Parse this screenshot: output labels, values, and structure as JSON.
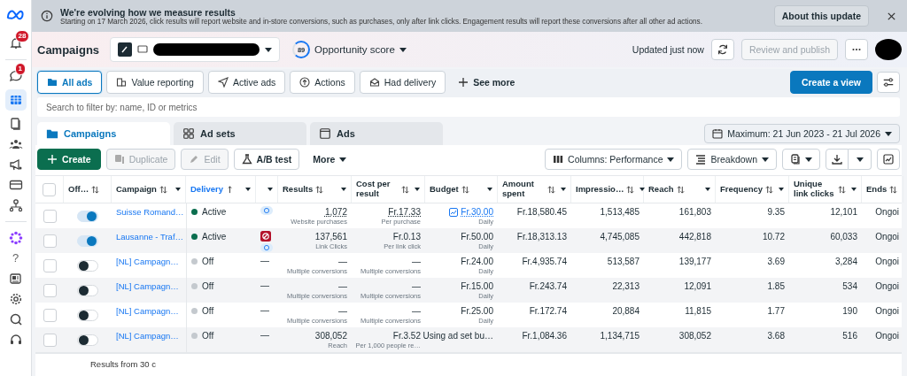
{
  "banner": {
    "title": "We're evolving how we measure results",
    "text": "Starting on 17 March 2026, click results will report website and in-store conversions, such as purchases, only after link clicks. Engagement results will report these conversions after all other ad actions.",
    "button": "About this update"
  },
  "sidebar": {
    "notifications_badge": "28",
    "messages_badge": "1",
    "help_glyph": "?"
  },
  "header": {
    "title": "Campaigns",
    "opportunity_score": "89",
    "opportunity_label": "Opportunity score",
    "updated": "Updated just now",
    "publish_button": "Review and publish",
    "publish_disabled": true
  },
  "filters": [
    {
      "kind": "folder",
      "label": "All ads",
      "selected": true
    },
    {
      "kind": "value",
      "label": "Value reporting",
      "selected": false
    },
    {
      "kind": "send",
      "label": "Active ads",
      "selected": false
    },
    {
      "kind": "actions",
      "label": "Actions",
      "selected": false
    },
    {
      "kind": "delivery",
      "label": "Had delivery",
      "selected": false
    }
  ],
  "see_more": "See more",
  "create_view": "Create a view",
  "search": {
    "placeholder": "Search to filter by: name, ID or metrics"
  },
  "tabs": [
    {
      "kind": "campaigns",
      "label": "Campaigns",
      "selected": true
    },
    {
      "kind": "adsets",
      "label": "Ad sets",
      "selected": false
    },
    {
      "kind": "ads",
      "label": "Ads",
      "selected": false
    }
  ],
  "date_range": "Maximum: 21 Jun 2023 - 21 Jul 2026",
  "toolbar": {
    "create": "Create",
    "actions": [
      {
        "kind": "duplicate",
        "label": "Duplicate",
        "disabled": true
      },
      {
        "kind": "edit",
        "label": "Edit",
        "disabled": true
      },
      {
        "kind": "abtest",
        "label": "A/B test",
        "disabled": false
      }
    ],
    "more": "More",
    "columns": "Columns: Performance",
    "breakdown": "Breakdown"
  },
  "table": {
    "all_checked": false,
    "columns": [
      {
        "label": "Off…",
        "sortable": true,
        "sorted": false,
        "menu": false
      },
      {
        "label": "Campaign",
        "sortable": true,
        "sorted": false,
        "menu": true
      },
      {
        "label": "Delivery",
        "sortable": true,
        "sorted": true,
        "menu": true
      },
      {
        "sortable": false,
        "menu": true
      },
      {
        "label": "Results",
        "sortable": true,
        "sorted": false,
        "menu": true
      },
      {
        "label": "Cost per result",
        "sortable": true,
        "sorted": false,
        "menu": true
      },
      {
        "label": "Budget",
        "sortable": true,
        "sorted": false,
        "menu": true
      },
      {
        "label": "Amount spent",
        "sortable": true,
        "sorted": false,
        "menu": true
      },
      {
        "label": "Impressio…",
        "sortable": true,
        "sorted": false,
        "menu": true
      },
      {
        "label": "Reach",
        "sortable": true,
        "sorted": false,
        "menu": true
      },
      {
        "label": "Frequency",
        "sortable": true,
        "sorted": false,
        "menu": true
      },
      {
        "label": "Unique link clicks",
        "sortable": true,
        "sorted": false,
        "menu": true
      },
      {
        "label": "Ends",
        "sortable": true,
        "sorted": false,
        "menu": false
      }
    ],
    "rows": [
      {
        "checked": false,
        "on": true,
        "name": "Suisse Romand…",
        "delivery": "Active",
        "delivery_on": true,
        "attribution": {
          "kind": "icons",
          "icons": [
            {
              "kind": "setting"
            }
          ]
        },
        "underlined": true,
        "results": "1,072",
        "results_sub": "Website purchases",
        "cost": "Fr.17.33",
        "cost_sub": "Per purchase",
        "budget_link": true,
        "budget": "Fr.30.00",
        "budget_sub": "Daily",
        "amount": "Fr.18,580.45",
        "impressions": "1,513,485",
        "reach": "161,803",
        "frequency": "9.35",
        "unique": "12,101",
        "ends": "Ongoi"
      },
      {
        "checked": false,
        "on": true,
        "name": "Lausanne - Traf…",
        "delivery": "Active",
        "delivery_on": true,
        "attribution": {
          "kind": "icons",
          "icons": [
            {
              "kind": "blocked"
            },
            {
              "kind": "setting"
            }
          ]
        },
        "underlined": false,
        "results": "137,561",
        "results_sub": "Link Clicks",
        "cost": "Fr.0.13",
        "cost_sub": "Per link click",
        "budget_link": false,
        "budget": "Fr.50.00",
        "budget_sub": "Daily",
        "amount": "Fr.18,313.13",
        "impressions": "4,745,085",
        "reach": "442,818",
        "frequency": "10.72",
        "unique": "60,033",
        "ends": "Ongoi"
      },
      {
        "checked": false,
        "on": false,
        "name": "[NL] Campagn…",
        "delivery": "Off",
        "delivery_on": false,
        "attribution": {
          "kind": "text",
          "text": "—"
        },
        "underlined": false,
        "results": "—",
        "results_sub": "Multiple conversions",
        "cost": "—",
        "cost_sub": "Multiple conversions",
        "budget_link": false,
        "budget": "Fr.24.00",
        "budget_sub": "Daily",
        "amount": "Fr.4,935.74",
        "impressions": "513,587",
        "reach": "139,177",
        "frequency": "3.69",
        "unique": "3,284",
        "ends": "Ongoi"
      },
      {
        "checked": false,
        "on": false,
        "name": "[NL] Campagn…",
        "delivery": "Off",
        "delivery_on": false,
        "attribution": {
          "kind": "text",
          "text": "—"
        },
        "underlined": false,
        "results": "—",
        "results_sub": "Multiple conversions",
        "cost": "—",
        "cost_sub": "Multiple conversions",
        "budget_link": false,
        "budget": "Fr.15.00",
        "budget_sub": "Daily",
        "amount": "Fr.243.74",
        "impressions": "22,313",
        "reach": "12,091",
        "frequency": "1.85",
        "unique": "534",
        "ends": "Ongoi"
      },
      {
        "checked": false,
        "on": false,
        "name": "[NL] Campagn…",
        "delivery": "Off",
        "delivery_on": false,
        "attribution": {
          "kind": "text",
          "text": "—"
        },
        "underlined": false,
        "results": "—",
        "results_sub": "Multiple conversions",
        "cost": "—",
        "cost_sub": "Multiple conversions",
        "budget_link": false,
        "budget": "Fr.25.00",
        "budget_sub": "Daily",
        "amount": "Fr.172.74",
        "impressions": "20,884",
        "reach": "11,815",
        "frequency": "1.77",
        "unique": "190",
        "ends": "Ongoi"
      },
      {
        "checked": false,
        "on": false,
        "name": "[NL] Campagn…",
        "delivery": "Off",
        "delivery_on": false,
        "attribution": {
          "kind": "text",
          "text": "—"
        },
        "underlined": false,
        "results": "308,052",
        "results_sub": "Reach",
        "cost": "Fr.3.52",
        "cost_sub": "Per 1,000 people re…",
        "budget_link": false,
        "budget": "Using ad set bu…",
        "amount": "Fr.1,084.36",
        "impressions": "1,134,715",
        "reach": "308,052",
        "frequency": "3.68",
        "unique": "516",
        "ends": "Ongoi"
      }
    ],
    "footer": "Results from 30 c"
  }
}
